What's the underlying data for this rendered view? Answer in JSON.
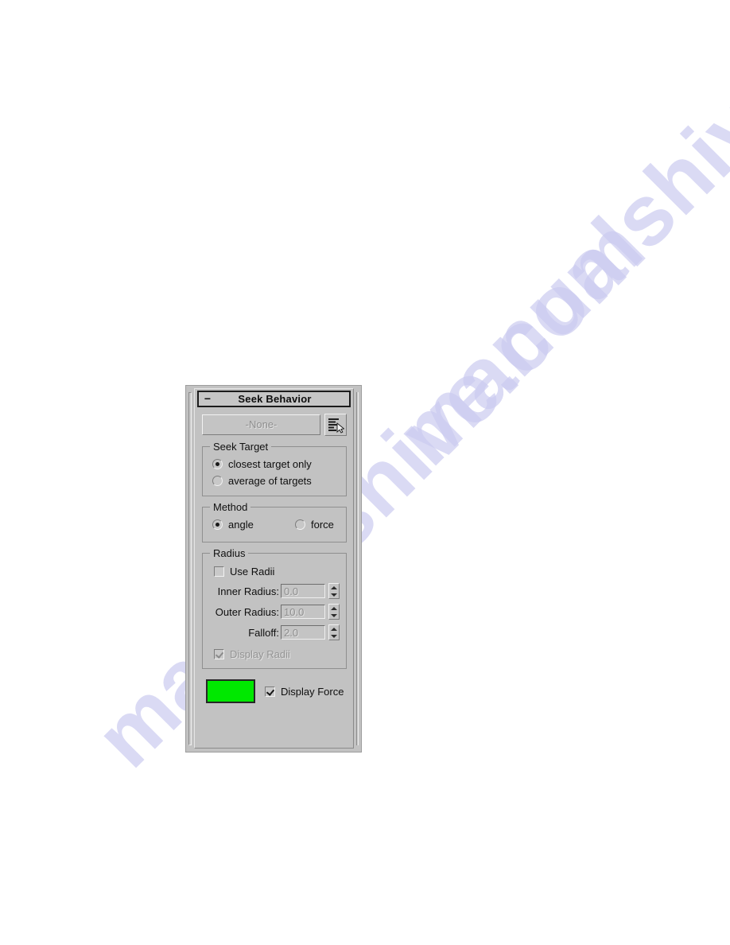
{
  "page": {
    "background_color": "#ffffff",
    "watermark_text": "manualshive.com",
    "watermark_color": "#ccccf0"
  },
  "rollout": {
    "title": "Seek Behavior",
    "collapse_icon": "−",
    "collapse_state": "expanded",
    "panel_background": "#c2c2c2",
    "target_picker": {
      "button_label": "-None-",
      "button_enabled": false,
      "pick_icon": "select-by-list-icon"
    },
    "seek_target_group": {
      "title": "Seek Target",
      "options": [
        {
          "label": "closest target only",
          "selected": true
        },
        {
          "label": "average of targets",
          "selected": false
        }
      ]
    },
    "method_group": {
      "title": "Method",
      "options": [
        {
          "label": "angle",
          "selected": true
        },
        {
          "label": "force",
          "selected": false
        }
      ]
    },
    "radius_group": {
      "title": "Radius",
      "use_radii": {
        "label": "Use Radii",
        "checked": false,
        "enabled": true
      },
      "fields": [
        {
          "label": "Inner Radius:",
          "value": "0.0",
          "enabled": false
        },
        {
          "label": "Outer Radius:",
          "value": "10.0",
          "enabled": false
        },
        {
          "label": "Falloff:",
          "value": "2.0",
          "enabled": false
        }
      ],
      "display_radii": {
        "label": "Display Radii",
        "checked": true,
        "enabled": false
      }
    },
    "force_display": {
      "color_swatch": "#00e800",
      "checkbox": {
        "label": "Display Force",
        "checked": true,
        "enabled": true
      }
    }
  }
}
